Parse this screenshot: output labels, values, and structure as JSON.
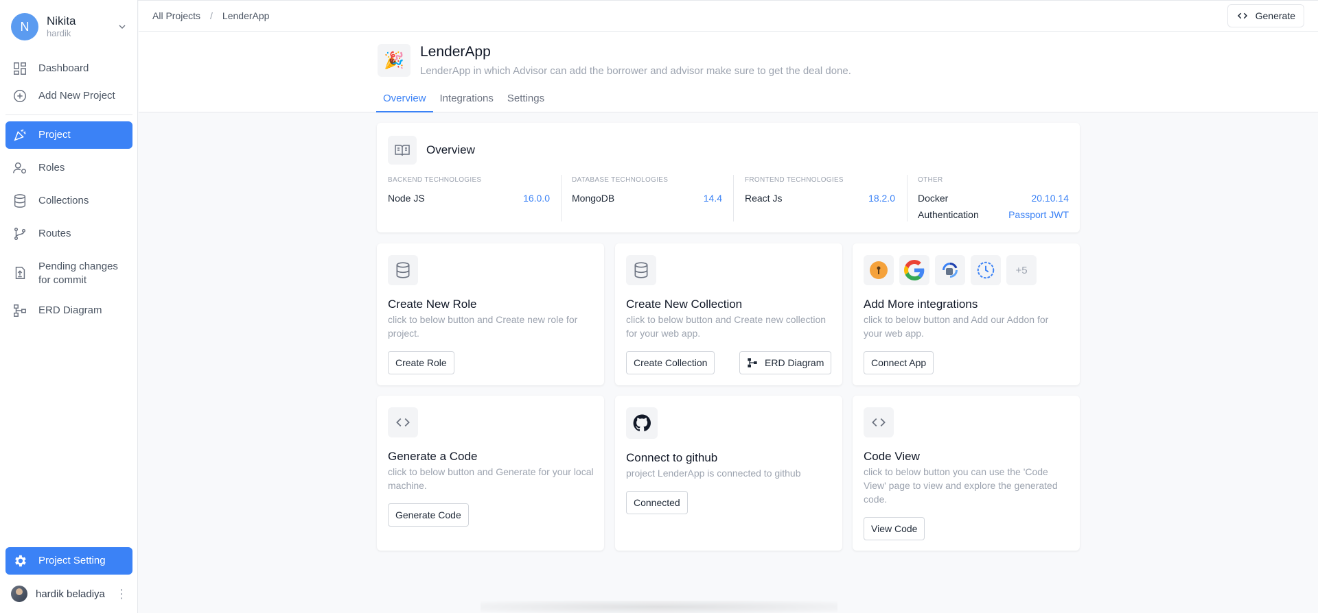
{
  "sidebar": {
    "user": {
      "initial": "N",
      "name": "Nikita",
      "sub": "hardik"
    },
    "items": [
      {
        "label": "Dashboard"
      },
      {
        "label": "Add New Project"
      },
      {
        "label": "Project"
      },
      {
        "label": "Roles"
      },
      {
        "label": "Collections"
      },
      {
        "label": "Routes"
      },
      {
        "label": "Pending changes for commit"
      },
      {
        "label": "ERD Diagram"
      }
    ],
    "project_setting": "Project Setting",
    "bottom_user": "hardik beladiya"
  },
  "header": {
    "breadcrumb": [
      "All Projects",
      "LenderApp"
    ],
    "separator": "/",
    "generate_label": "Generate"
  },
  "project": {
    "title": "LenderApp",
    "description": "LenderApp in which Advisor can add the borrower and advisor make sure to get the deal done.",
    "tabs": [
      "Overview",
      "Integrations",
      "Settings"
    ]
  },
  "overview": {
    "title": "Overview",
    "columns": [
      {
        "caption": "BACKEND TECHNOLOGIES",
        "rows": [
          {
            "name": "Node JS",
            "version": "16.0.0"
          }
        ]
      },
      {
        "caption": "DATABASE TECHNOLOGIES",
        "rows": [
          {
            "name": "MongoDB",
            "version": "14.4"
          }
        ]
      },
      {
        "caption": "FRONTEND TECHNOLOGIES",
        "rows": [
          {
            "name": "React Js",
            "version": "18.2.0"
          }
        ]
      },
      {
        "caption": "OTHER",
        "rows": [
          {
            "name": "Docker",
            "version": "20.10.14"
          },
          {
            "name": "Authentication",
            "version": "Passport JWT"
          }
        ]
      }
    ]
  },
  "cards": {
    "role": {
      "title": "Create New Role",
      "desc": "click to below button and Create new role for project.",
      "button": "Create Role"
    },
    "collection": {
      "title": "Create New Collection",
      "desc": "click to below button and Create new collection for your web app.",
      "button": "Create Collection",
      "button2": "ERD Diagram"
    },
    "integrations": {
      "title": "Add More integrations",
      "desc": "click to below button and Add our Addon for your web app.",
      "button": "Connect App",
      "more": "+5"
    },
    "code": {
      "title": "Generate a Code",
      "desc": "click to below button and Generate for your local machine.",
      "button": "Generate Code"
    },
    "github": {
      "title": "Connect to github",
      "desc": "project LenderApp is connected to github",
      "button": "Connected"
    },
    "codeview": {
      "title": "Code View",
      "desc": "click to below button you can use the 'Code View' page to view and explore the generated code.",
      "button": "View Code"
    }
  },
  "colors": {
    "accent": "#3b82f6",
    "avatar": "#5b9bf0"
  }
}
